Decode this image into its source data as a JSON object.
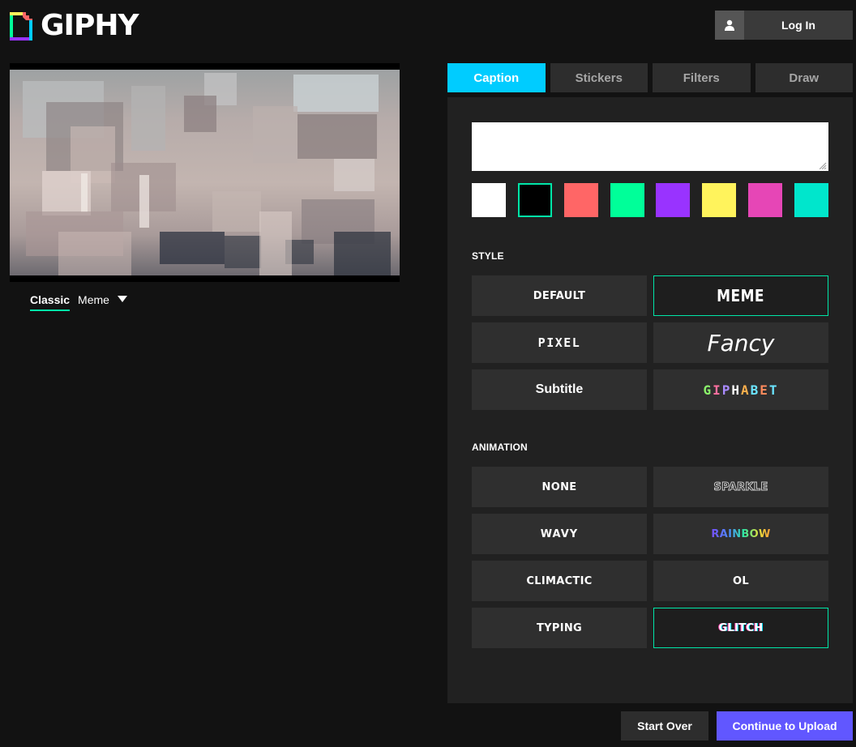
{
  "header": {
    "brand": "GIPHY",
    "login_label": "Log In"
  },
  "preview": {
    "mode_tabs": [
      "Classic",
      "Meme"
    ]
  },
  "tabs": [
    {
      "label": "Caption",
      "active": true
    },
    {
      "label": "Stickers",
      "active": false
    },
    {
      "label": "Filters",
      "active": false
    },
    {
      "label": "Draw",
      "active": false
    }
  ],
  "caption": {
    "value": "",
    "placeholder": ""
  },
  "colors": [
    {
      "name": "white",
      "hex": "#ffffff",
      "selected": false
    },
    {
      "name": "black",
      "hex": "#000000",
      "selected": true
    },
    {
      "name": "red",
      "hex": "#ff6666",
      "selected": false
    },
    {
      "name": "green",
      "hex": "#00ff99",
      "selected": false
    },
    {
      "name": "purple",
      "hex": "#9933ff",
      "selected": false
    },
    {
      "name": "yellow",
      "hex": "#fff35c",
      "selected": false
    },
    {
      "name": "pink",
      "hex": "#e646b6",
      "selected": false
    },
    {
      "name": "teal",
      "hex": "#00e6cc",
      "selected": false
    }
  ],
  "style": {
    "title": "STYLE",
    "options": [
      {
        "label": "DEFAULT",
        "selected": false
      },
      {
        "label": "MEME",
        "selected": true
      },
      {
        "label": "PIXEL",
        "selected": false
      },
      {
        "label": "Fancy",
        "selected": false
      },
      {
        "label": "Subtitle",
        "selected": false
      },
      {
        "label": "GIPHABET",
        "selected": false
      }
    ]
  },
  "animation": {
    "title": "ANIMATION",
    "options": [
      {
        "label": "NONE",
        "selected": false
      },
      {
        "label": "SPARKLE",
        "selected": false
      },
      {
        "label": "WAVY",
        "selected": false
      },
      {
        "label": "RAINBOW",
        "selected": false
      },
      {
        "label": "CLIMACTIC",
        "selected": false
      },
      {
        "label": "OL",
        "selected": false
      },
      {
        "label": "TYPING",
        "selected": false
      },
      {
        "label": "GLITCH",
        "selected": true
      }
    ]
  },
  "actions": {
    "start_over": "Start Over",
    "continue": "Continue to Upload"
  },
  "accent_colors": {
    "tab_active": "#00ccff",
    "selection": "#00e6a8",
    "primary_button": "#6157ff"
  }
}
